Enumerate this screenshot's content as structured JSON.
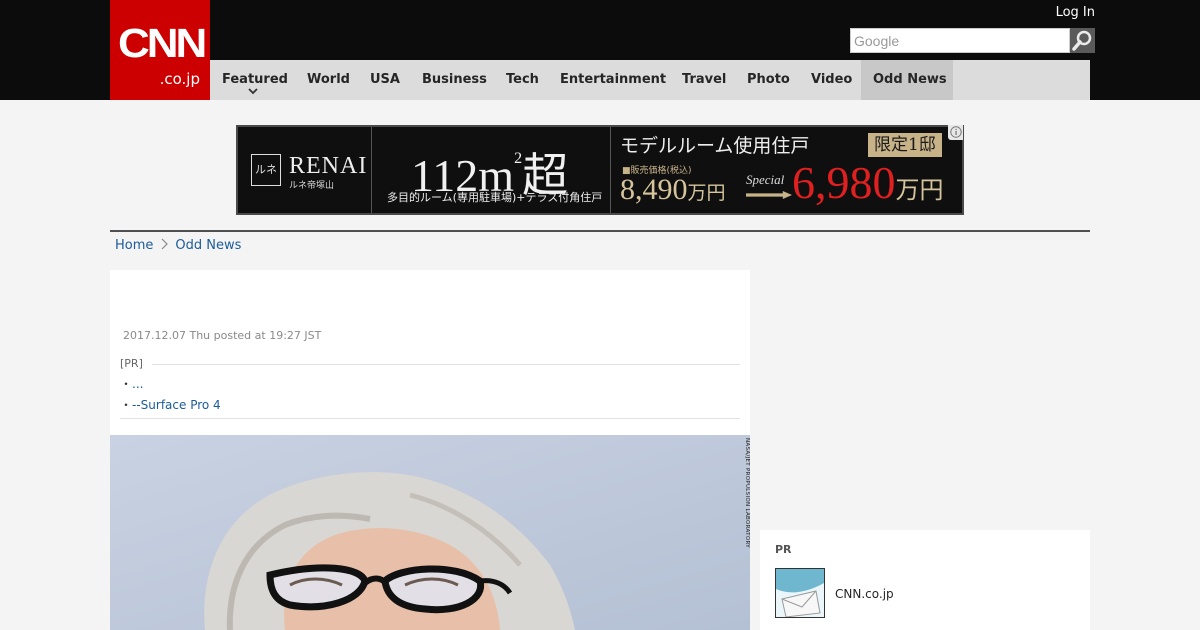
{
  "header": {
    "logo_main": "CNN",
    "logo_sub": ".co.jp",
    "login_label": "Log In",
    "search_placeholder": "Google",
    "nav": [
      {
        "label": "Featured"
      },
      {
        "label": "World"
      },
      {
        "label": "USA"
      },
      {
        "label": "Business"
      },
      {
        "label": "Tech"
      },
      {
        "label": "Entertainment"
      },
      {
        "label": "Travel"
      },
      {
        "label": "Photo"
      },
      {
        "label": "Video"
      },
      {
        "label": "Odd News"
      }
    ],
    "active_nav": "Odd News"
  },
  "ad_banner": {
    "brand": "RENAI",
    "brand_mark": "ルネ",
    "brand_sub": "ルネ帝塚山",
    "area": "112m",
    "area_sup": "2",
    "area_suffix": "超",
    "description": "多目的ルーム(専用駐車場)+テラス付角住戸",
    "headline": "モデルルーム使用住戸",
    "badge": "限定1邸",
    "price_label": "■販売価格(税込)",
    "old_price": "8,490",
    "price_unit": "万円",
    "special_label": "Special",
    "new_price": "6,980"
  },
  "breadcrumb": {
    "home": "Home",
    "section": "Odd News"
  },
  "article": {
    "posted": "2017.12.07 Thu posted at 19:27 JST",
    "pr_label": "[PR]",
    "pr_links": [
      {
        "bullet": "・",
        "text": "..."
      },
      {
        "bullet": "・",
        "text": "--Surface Pro 4"
      }
    ],
    "photo_credit": "NASA/JET PROPULSION LABORATORY"
  },
  "sidebar": {
    "pr_label": "PR",
    "pr_item_text": "CNN.co.jp"
  },
  "colors": {
    "header_bg": "#0c0c0c",
    "logo_red": "#cc0000",
    "nav_bg": "#dcdcdc",
    "link_blue": "#1c5b9b",
    "page_bg": "#f4f4f4"
  }
}
